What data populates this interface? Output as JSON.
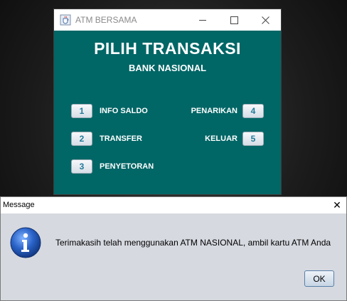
{
  "atm_window": {
    "title": "ATM BERSAMA",
    "app_icon": "java-cup-icon",
    "controls": {
      "minimize": "minimize-icon",
      "maximize": "maximize-icon",
      "close": "close-icon"
    },
    "heading": "PILIH TRANSAKSI",
    "subheading": "BANK NASIONAL",
    "background_color": "#006666",
    "options": [
      {
        "number": "1",
        "label": "INFO SALDO"
      },
      {
        "number": "2",
        "label": "TRANSFER"
      },
      {
        "number": "3",
        "label": "PENYETORAN"
      },
      {
        "number": "4",
        "label": "PENARIKAN"
      },
      {
        "number": "5",
        "label": "KELUAR"
      }
    ]
  },
  "dialog": {
    "title": "Message",
    "close_glyph": "✕",
    "icon": "info-icon",
    "message": "Terimakasih telah menggunakan ATM NASIONAL, ambil kartu ATM Anda",
    "ok_label": "OK"
  }
}
